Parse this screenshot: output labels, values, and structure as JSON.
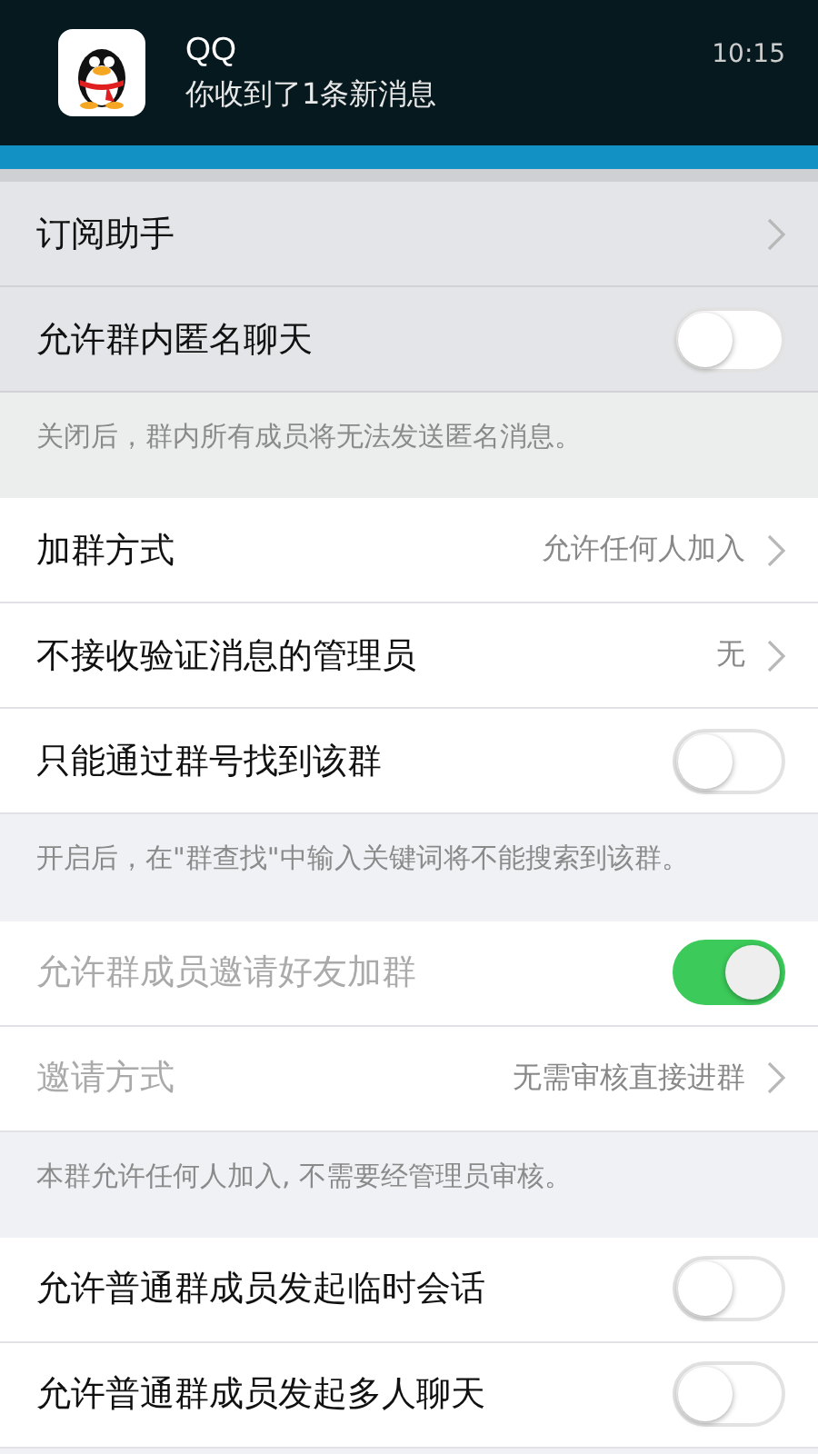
{
  "notification": {
    "app": "QQ",
    "message": "你收到了1条新消息",
    "time": "10:15"
  },
  "items": [
    {
      "kind": "link",
      "label": "订阅助手",
      "disabled": false
    },
    {
      "kind": "switch",
      "label": "允许群内匿名聊天",
      "on": false,
      "disabled": false
    },
    {
      "kind": "note",
      "text": "关闭后，群内所有成员将无法发送匿名消息。"
    },
    {
      "kind": "link",
      "label": "加群方式",
      "value": "允许任何人加入",
      "disabled": false
    },
    {
      "kind": "link",
      "label": "不接收验证消息的管理员",
      "value": "无",
      "disabled": false
    },
    {
      "kind": "switch",
      "label": "只能通过群号找到该群",
      "on": false,
      "disabled": false
    },
    {
      "kind": "note",
      "text": "开启后，在\"群查找\"中输入关键词将不能搜索到该群。"
    },
    {
      "kind": "switch",
      "label": "允许群成员邀请好友加群",
      "on": true,
      "disabled": true
    },
    {
      "kind": "link",
      "label": "邀请方式",
      "value": "无需审核直接进群",
      "disabled": true
    },
    {
      "kind": "note",
      "text": "本群允许任何人加入, 不需要经管理员审核。"
    },
    {
      "kind": "switch",
      "label": "允许普通群成员发起临时会话",
      "on": false,
      "disabled": false
    },
    {
      "kind": "switch",
      "label": "允许普通群成员发起多人聊天",
      "on": false,
      "disabled": false
    }
  ]
}
